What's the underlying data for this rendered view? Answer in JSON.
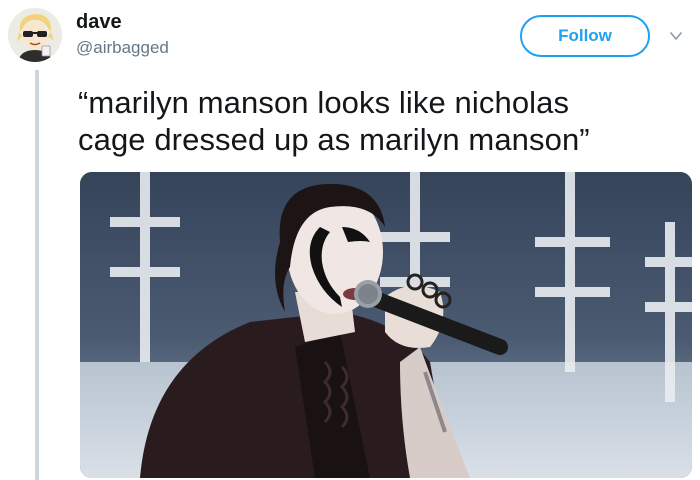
{
  "user": {
    "display_name": "dave",
    "handle": "@airbagged",
    "avatar_icon": "cartoon-avatar-icon"
  },
  "actions": {
    "follow_label": "Follow",
    "more_icon": "chevron-down-icon"
  },
  "tweet": {
    "text_lines": [
      "“marilyn manson looks like nicholas",
      "cage dressed up as marilyn manson”"
    ],
    "media_icon": "photo-performer-with-microphone"
  },
  "colors": {
    "accent": "#1da1f2",
    "text": "#14171a",
    "secondary": "#657786",
    "thread": "#ccd6dd"
  }
}
